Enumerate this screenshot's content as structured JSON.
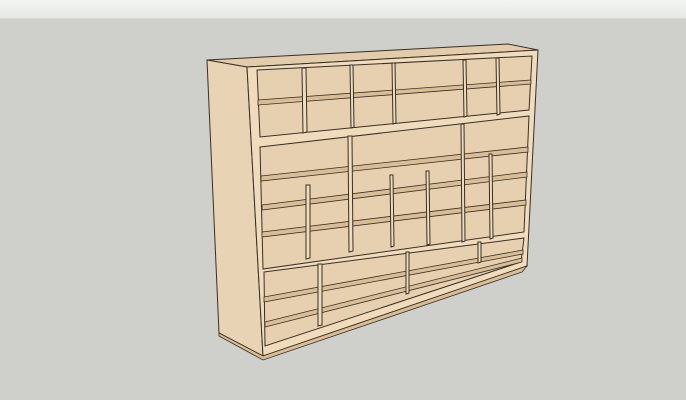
{
  "window": {
    "title": ""
  },
  "viewport": {
    "background_color": "#cfd0cc",
    "model": {
      "description_icon": "bookshelf-model",
      "colors": {
        "side_panel": "#e8d3b4",
        "front_face": "#f0dcbd",
        "interior_back": "#e6d0b0",
        "shelf_top": "#d8bd96",
        "edge_line": "#3a2f25",
        "top_surface": "#e2ccab"
      }
    }
  }
}
